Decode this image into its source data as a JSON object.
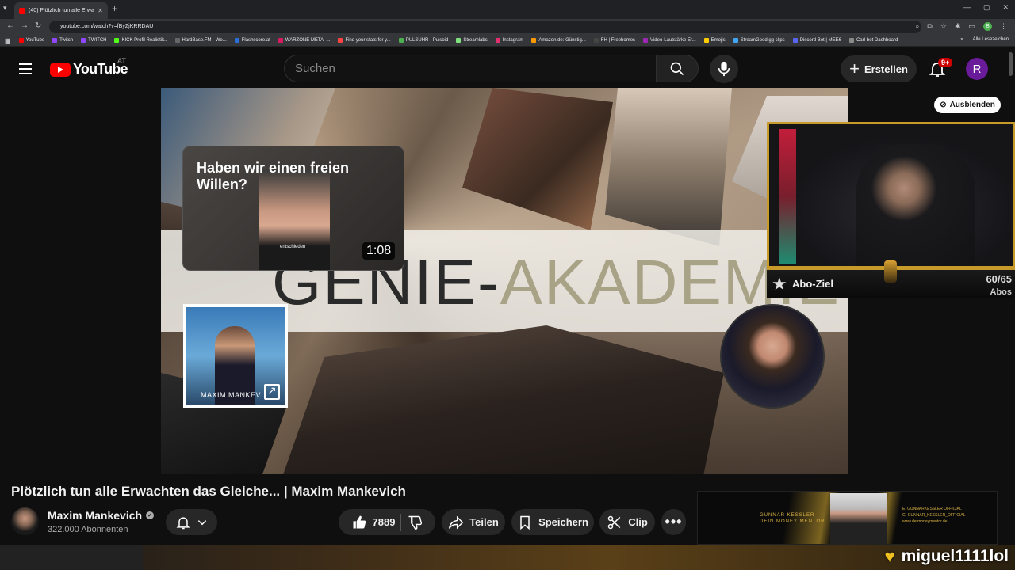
{
  "browser": {
    "tab_title": "(40) Plötzlich tun alle Erwachten",
    "url": "youtube.com/watch?v=fByZjKRRDAU",
    "bookmarks": [
      "YouTube",
      "Twitch",
      "TWITCH",
      "KICK Profil Realistik..",
      "HardBase.FM - We...",
      "Flashscore.at",
      "WARZONE META -...",
      "Find your stats for y...",
      "PULSUHR - Pulsoid",
      "Streamlabs",
      "Instagram",
      "Amazon.de: Günstig...",
      "FH | Freehomes",
      "Video-Lautstärke Er...",
      "Emojis",
      "StreamGood.gg clips",
      "Discord Bot | MEE6",
      "Carl-bot Dashboard"
    ],
    "bookmarks_overflow": "»",
    "all_bookmarks": "Alle Lesezeichen"
  },
  "youtube": {
    "logo_text": "YouTube",
    "country": "AT",
    "search_placeholder": "Suchen",
    "create_label": "Erstellen",
    "notif_badge": "9+",
    "avatar_letter": "R"
  },
  "video": {
    "banner_part1": "GENIE-",
    "banner_part2": "AKADEMIE",
    "card_title": "Haben wir einen freien Willen?",
    "card_duration": "1:08",
    "card_caption": "entschieden",
    "card2_caption": "MAXIM MANKEV"
  },
  "stream_overlay": {
    "hide_label": "Ausblenden",
    "goal_label": "Abo-Ziel",
    "goal_count": "60/65",
    "goal_unit": "Abos",
    "chat_user": "miguel1111lol"
  },
  "info": {
    "title": "Plötzlich tun alle Erwachten das Gleiche... | Maxim Mankevich",
    "channel": "Maxim Mankevich",
    "subscribers": "322.000 Abonnenten",
    "likes": "7889",
    "share": "Teilen",
    "save": "Speichern",
    "clip": "Clip"
  },
  "ad": {
    "brand_line1": "GUNNAR KESSLER",
    "brand_line2": "DEIN MONEY MENTOR",
    "right_line1": "E. GUNNARKESSLER OFFICIAL",
    "right_line2": "G. GUNNAR_KESSLER_OFFICIAL",
    "right_line3": "www.dermoneymentor.de"
  }
}
